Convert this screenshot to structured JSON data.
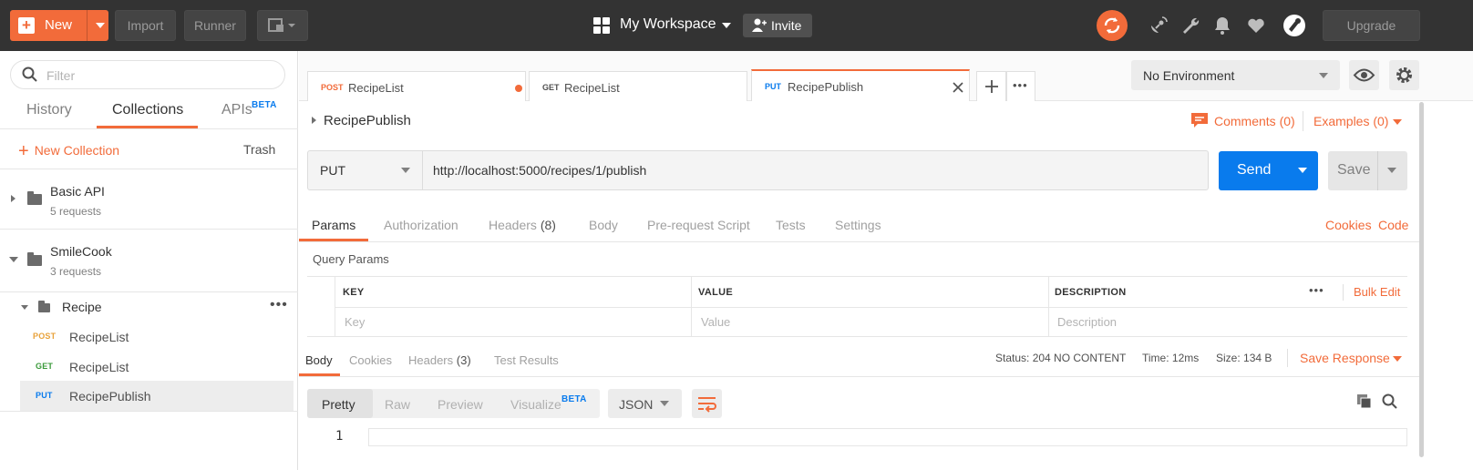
{
  "topbar": {
    "new_label": "New",
    "import_label": "Import",
    "runner_label": "Runner",
    "workspace_label": "My Workspace",
    "invite_label": "Invite",
    "upgrade_label": "Upgrade"
  },
  "sidebar": {
    "filter_placeholder": "Filter",
    "tabs": [
      {
        "label": "History"
      },
      {
        "label": "Collections"
      },
      {
        "label": "APIs",
        "badge": "BETA"
      }
    ],
    "new_collection_label": "New Collection",
    "trash_label": "Trash",
    "collections": [
      {
        "name": "Basic API",
        "count": "5 requests"
      },
      {
        "name": "SmileCook",
        "count": "3 requests"
      }
    ],
    "folder": {
      "name": "Recipe"
    },
    "requests": [
      {
        "method": "POST",
        "name": "RecipeList"
      },
      {
        "method": "GET",
        "name": "RecipeList"
      },
      {
        "method": "PUT",
        "name": "RecipePublish"
      }
    ]
  },
  "tabs": [
    {
      "method": "POST",
      "name": "RecipeList"
    },
    {
      "method": "GET",
      "name": "RecipeList"
    },
    {
      "method": "PUT",
      "name": "RecipePublish"
    }
  ],
  "environment": {
    "selected": "No Environment"
  },
  "request": {
    "title": "RecipePublish",
    "comments_label": "Comments (0)",
    "examples_label": "Examples (0)",
    "method": "PUT",
    "url": "http://localhost:5000/recipes/1/publish",
    "send_label": "Send",
    "save_label": "Save",
    "subtabs": [
      {
        "label": "Params"
      },
      {
        "label": "Authorization"
      },
      {
        "label": "Headers"
      },
      {
        "label": "Body"
      },
      {
        "label": "Pre-request Script"
      },
      {
        "label": "Tests"
      },
      {
        "label": "Settings"
      }
    ],
    "headers_count": "(8)",
    "cookies_label": "Cookies",
    "code_label": "Code"
  },
  "params": {
    "title": "Query Params",
    "columns": [
      "KEY",
      "VALUE",
      "DESCRIPTION"
    ],
    "placeholders": [
      "Key",
      "Value",
      "Description"
    ],
    "bulk_edit_label": "Bulk Edit",
    "more_label": "•••"
  },
  "response": {
    "tabs": [
      {
        "label": "Body"
      },
      {
        "label": "Cookies"
      },
      {
        "label": "Headers"
      },
      {
        "label": "Test Results"
      }
    ],
    "headers_count": "(3)",
    "status_label": "Status:",
    "status_value": "204 NO CONTENT",
    "time_label": "Time:",
    "time_value": "12ms",
    "size_label": "Size:",
    "size_value": "134 B",
    "save_response_label": "Save Response",
    "views": [
      "Pretty",
      "Raw",
      "Preview",
      "Visualize"
    ],
    "visualize_badge": "BETA",
    "format": "JSON",
    "line_number": "1"
  },
  "colors": {
    "accent": "#f26b3a",
    "primary_blue": "#097bed",
    "topbar": "#333333",
    "method_post": "#e8a23a",
    "method_get": "#3a9a3a",
    "method_put": "#097bed"
  },
  "icons": {
    "filter": "search-icon",
    "sync": "sync-icon",
    "satellite": "satellite-icon",
    "wrench": "wrench-icon",
    "bell": "bell-icon",
    "heart": "heart-icon",
    "interceptor": "interceptor-icon",
    "eye": "eye-icon",
    "gear": "gear-icon",
    "copy": "copy-icon",
    "search": "search-icon",
    "wrap": "wrap-lines-icon"
  }
}
